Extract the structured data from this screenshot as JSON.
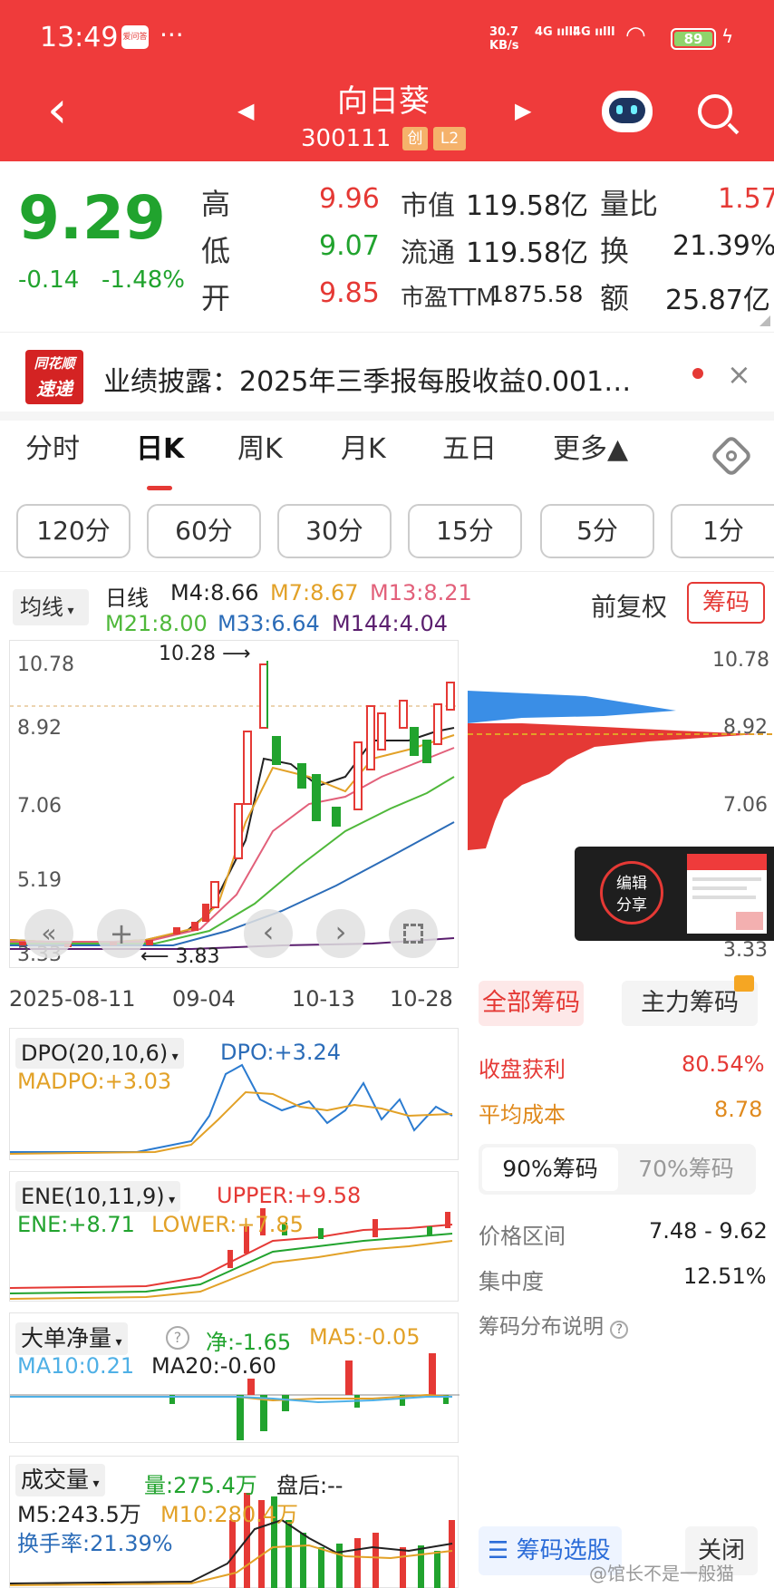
{
  "status": {
    "time": "13:49",
    "app_badge": "爱问答",
    "more": "···",
    "speed": "30.7 KB/s",
    "network1": "4G",
    "network2": "4G",
    "battery": "89"
  },
  "header": {
    "title": "向日葵",
    "code": "300111",
    "badge1": "创",
    "badge2": "L2"
  },
  "quote": {
    "price": "9.29",
    "change": "-0.14",
    "change_pct": "-1.48%",
    "high_label": "高",
    "high": "9.96",
    "low_label": "低",
    "low": "9.07",
    "open_label": "开",
    "open": "9.85",
    "mktcap_label": "市值",
    "mktcap": "119.58亿",
    "float_label": "流通",
    "float": "119.58亿",
    "pe_label": "市盈TTM",
    "pe": "1875.58",
    "volratio_label": "量比",
    "volratio": "1.57",
    "turnover_label": "换",
    "turnover": "21.39%",
    "amount_label": "额",
    "amount": "25.87亿"
  },
  "news": {
    "logo_top": "同花顺",
    "logo_bottom": "速递",
    "text": "业绩披露：2025年三季报每股收益0.001…",
    "close": "×"
  },
  "tabs": [
    "分时",
    "日K",
    "周K",
    "月K",
    "五日",
    "更多▲"
  ],
  "minute_buttons": [
    "120分",
    "60分",
    "30分",
    "15分",
    "5分",
    "1分"
  ],
  "ma": {
    "selector": "均线",
    "period": "日线",
    "m4": "M4:8.66",
    "m7": "M7:8.67",
    "m13": "M13:8.21",
    "m21": "M21:8.00",
    "m33": "M33:6.64",
    "m144": "M144:4.04",
    "adjust": "前复权",
    "chips_btn": "筹码"
  },
  "kline": {
    "y_ticks": [
      "10.78",
      "8.92",
      "7.06",
      "5.19",
      "3.33"
    ],
    "high_mark": "10.28",
    "low_mark": "3.83",
    "x_ticks": [
      "2025-08-11",
      "09-04",
      "10-13",
      "10-28"
    ]
  },
  "chips": {
    "y_ticks": [
      "10.78",
      "8.92",
      "7.06",
      "3.33"
    ],
    "tab_all": "全部筹码",
    "tab_main": "主力筹码",
    "profit_label": "收盘获利",
    "profit": "80.54%",
    "avgcost_label": "平均成本",
    "avgcost": "8.78",
    "seg90": "90%筹码",
    "seg70": "70%筹码",
    "range_label": "价格区间",
    "range": "7.48 - 9.62",
    "conc_label": "集中度",
    "conc": "12.51%",
    "explain": "筹码分布说明",
    "select_btn": "筹码选股",
    "close_btn": "关闭"
  },
  "edit_share": {
    "line1": "编辑",
    "line2": "分享"
  },
  "dpo": {
    "name": "DPO(20,10,6)",
    "dpo": "DPO:+3.24",
    "madpo": "MADPO:+3.03"
  },
  "ene": {
    "name": "ENE(10,11,9)",
    "upper": "UPPER:+9.58",
    "ene": "ENE:+8.71",
    "lower": "LOWER:+7.85"
  },
  "bigorder": {
    "name": "大单净量",
    "net": "净:-1.65",
    "ma5": "MA5:-0.05",
    "ma10": "MA10:0.21",
    "ma20": "MA20:-0.60"
  },
  "volume": {
    "name": "成交量",
    "vol": "量:275.4万",
    "after": "盘后:--",
    "m5": "M5:243.5万",
    "m10": "M10:280.4万",
    "turnover": "换手率:21.39%"
  },
  "watermark": "@馆长不是一般猫",
  "colors": {
    "header_bg": "#ef3b3b",
    "up": "#e53935",
    "down": "#21a32e"
  }
}
